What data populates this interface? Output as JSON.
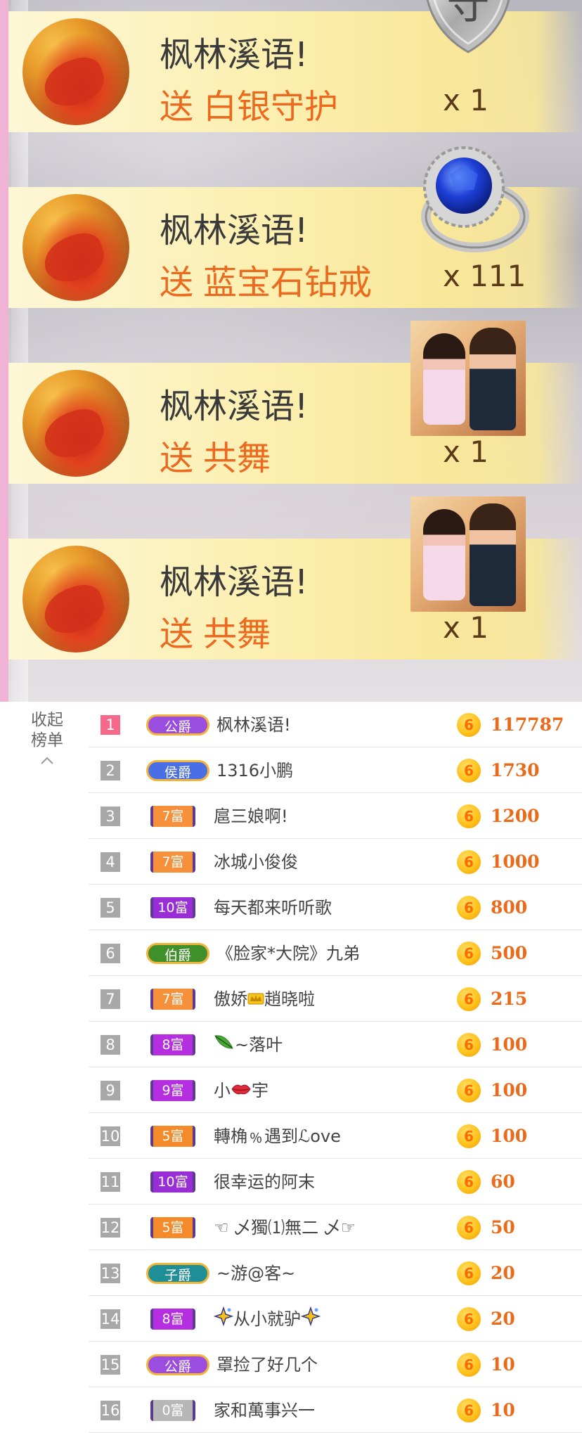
{
  "gifts": [
    {
      "sender": "枫林溪语!",
      "prefix": "送",
      "gift": "白银守护",
      "count": "x 1",
      "icon": "shield-icon",
      "icon_char": "守"
    },
    {
      "sender": "枫林溪语!",
      "prefix": "送",
      "gift": "蓝宝石钻戒",
      "count": "x 111",
      "icon": "sapphire-ring-icon"
    },
    {
      "sender": "枫林溪语!",
      "prefix": "送",
      "gift": "共舞",
      "count": "x 1",
      "icon": "couple-dance-icon"
    },
    {
      "sender": "枫林溪语!",
      "prefix": "送",
      "gift": "共舞",
      "count": "x 1",
      "icon": "couple-dance-icon"
    }
  ],
  "ranking": {
    "collapse_line1": "收起",
    "collapse_line2": "榜单",
    "coin_symbol": "6",
    "rows": [
      {
        "rank": "1",
        "badge": "公爵",
        "badge_type": "jue",
        "badge_color": "#9b4de0",
        "name": "枫林溪语!",
        "amount": "117787"
      },
      {
        "rank": "2",
        "badge": "侯爵",
        "badge_type": "jue",
        "badge_color": "#4a6ee6",
        "name": "1316小鹏",
        "amount": "1730"
      },
      {
        "rank": "3",
        "badge": "7富",
        "badge_type": "fu",
        "badge_color": "#f7903a",
        "name": "扈三娘啊!",
        "amount": "1200"
      },
      {
        "rank": "4",
        "badge": "7富",
        "badge_type": "fu",
        "badge_color": "#f7903a",
        "name": "冰城小俊俊",
        "amount": "1000"
      },
      {
        "rank": "5",
        "badge": "10富",
        "badge_type": "fu",
        "badge_color": "#9a2ed6",
        "name": "每天都来听听歌",
        "amount": "800"
      },
      {
        "rank": "6",
        "badge": "伯爵",
        "badge_type": "jue",
        "badge_color": "#3f8f2a",
        "name": "《脸家*大院》九弟",
        "amount": "500"
      },
      {
        "rank": "7",
        "badge": "7富",
        "badge_type": "fu",
        "badge_color": "#f7903a",
        "name_pre": "傲娇",
        "emoji": "crown-emoji",
        "name_post": "趙晓啦",
        "amount": "215"
      },
      {
        "rank": "8",
        "badge": "8富",
        "badge_type": "fu",
        "badge_color": "#b52fe0",
        "emoji": "leaf-emoji",
        "name_post": "~落叶",
        "amount": "100"
      },
      {
        "rank": "9",
        "badge": "9富",
        "badge_type": "fu",
        "badge_color": "#b52fe0",
        "name_pre": "小",
        "emoji": "lips-emoji",
        "name_post": "宇",
        "amount": "100"
      },
      {
        "rank": "10",
        "badge": "5富",
        "badge_type": "fu",
        "badge_color": "#f58a2a",
        "name": "轉桷﹪遇到ℒove",
        "amount": "100"
      },
      {
        "rank": "11",
        "badge": "10富",
        "badge_type": "fu",
        "badge_color": "#9a2ed6",
        "name": "很幸运的阿末",
        "amount": "60"
      },
      {
        "rank": "12",
        "badge": "5富",
        "badge_type": "fu",
        "badge_color": "#f58a2a",
        "name": "☜ 乄獨⑴無二 乄☞",
        "amount": "50"
      },
      {
        "rank": "13",
        "badge": "子爵",
        "badge_type": "jue",
        "badge_color": "#1e8f96",
        "name": "~游@客~",
        "amount": "20"
      },
      {
        "rank": "14",
        "badge": "8富",
        "badge_type": "fu",
        "badge_color": "#b52fe0",
        "emoji": "sparkle-emoji",
        "name_post": "从小就驴",
        "emoji2": "sparkle-emoji",
        "amount": "20"
      },
      {
        "rank": "15",
        "badge": "公爵",
        "badge_type": "jue",
        "badge_color": "#9b4de0",
        "name": "罩捡了好几个",
        "amount": "10"
      },
      {
        "rank": "16",
        "badge": "0富",
        "badge_type": "fu",
        "badge_color": "#b7b7b7",
        "name": "家和萬事兴一",
        "amount": "10"
      }
    ]
  }
}
